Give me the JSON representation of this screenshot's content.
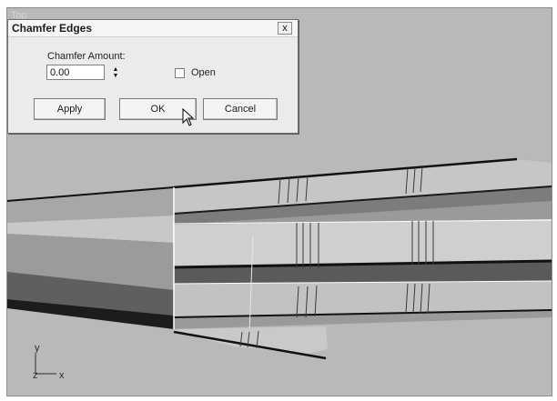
{
  "viewport": {
    "label": "Top"
  },
  "dialog": {
    "title": "Chamfer Edges",
    "close_label": "x",
    "chamfer_amount_label": "Chamfer Amount:",
    "chamfer_amount_value": "0.00",
    "open_label": "Open",
    "open_checked": false,
    "apply_label": "Apply",
    "ok_label": "OK",
    "cancel_label": "Cancel"
  },
  "axis": {
    "y": "y",
    "z": "z",
    "x": "x"
  }
}
